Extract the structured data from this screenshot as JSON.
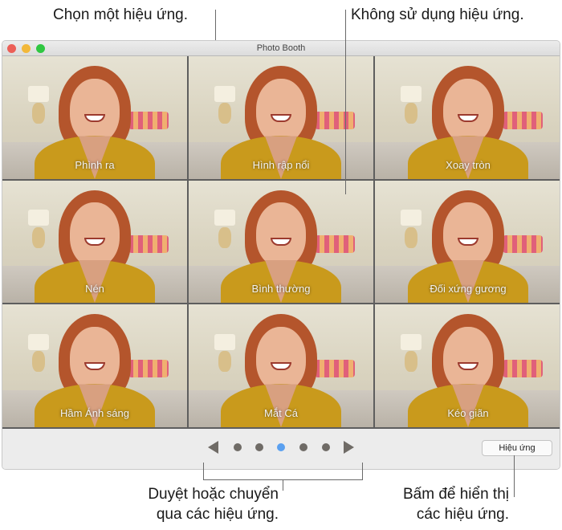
{
  "callouts": {
    "choose_effect": "Chọn một hiệu ứng.",
    "no_effect": "Không sử dụng hiệu ứng.",
    "browse_line1": "Duyệt hoặc chuyển",
    "browse_line2": "qua các hiệu ứng.",
    "click_line1": "Bấm để hiển thị",
    "click_line2": "các hiệu ứng."
  },
  "window": {
    "title": "Photo Booth"
  },
  "effects": [
    {
      "label": "Phình ra"
    },
    {
      "label": "Hình rập nổi"
    },
    {
      "label": "Xoay tròn"
    },
    {
      "label": "Nén"
    },
    {
      "label": "Bình thường"
    },
    {
      "label": "Đối xứng gương"
    },
    {
      "label": "Hầm Ánh sáng"
    },
    {
      "label": "Mắt Cá"
    },
    {
      "label": "Kéo giãn"
    }
  ],
  "pager": {
    "pages": 5,
    "current_page": 3,
    "active_color": "#5aa0f0",
    "inactive_color": "#6f6b66"
  },
  "effects_button": "Hiệu ứng"
}
